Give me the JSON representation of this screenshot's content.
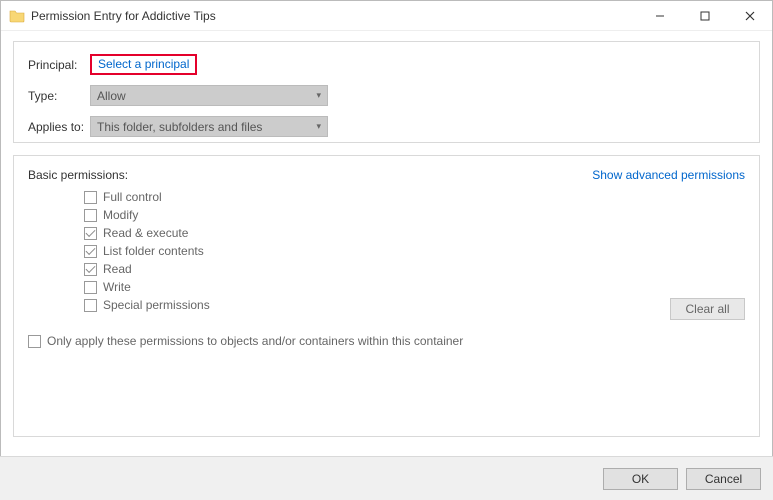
{
  "titlebar": {
    "title": "Permission Entry for Addictive Tips"
  },
  "form": {
    "principal_label": "Principal:",
    "select_principal": "Select a principal",
    "type_label": "Type:",
    "type_value": "Allow",
    "applies_label": "Applies to:",
    "applies_value": "This folder, subfolders and files"
  },
  "perms": {
    "title": "Basic permissions:",
    "advanced_link": "Show advanced permissions",
    "items": [
      {
        "label": "Full control",
        "checked": false
      },
      {
        "label": "Modify",
        "checked": false
      },
      {
        "label": "Read & execute",
        "checked": true
      },
      {
        "label": "List folder contents",
        "checked": true
      },
      {
        "label": "Read",
        "checked": true
      },
      {
        "label": "Write",
        "checked": false
      },
      {
        "label": "Special permissions",
        "checked": false
      }
    ],
    "only_apply": "Only apply these permissions to objects and/or containers within this container",
    "clear_all": "Clear all"
  },
  "footer": {
    "ok": "OK",
    "cancel": "Cancel"
  }
}
